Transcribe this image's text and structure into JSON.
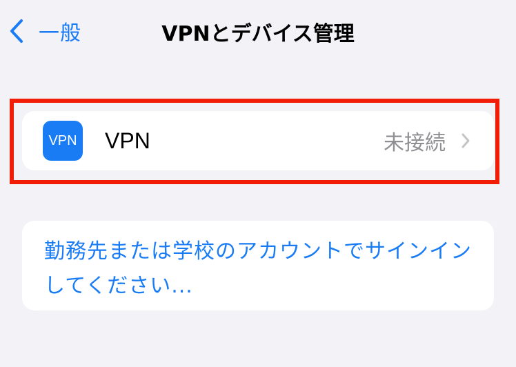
{
  "nav": {
    "back_label": "一般",
    "title": "VPNとデバイス管理"
  },
  "vpn_row": {
    "icon_text": "VPN",
    "label": "VPN",
    "status": "未接続"
  },
  "signin": {
    "text": "勤務先または学校のアカウントでサインインしてください..."
  },
  "colors": {
    "accent": "#1a7cf5",
    "highlight": "#f21d06",
    "background": "#f2f2f7",
    "secondary_text": "#8e8e93"
  },
  "icons": {
    "back": "chevron-left-icon",
    "row_disclosure": "chevron-right-icon",
    "vpn_app": "vpn-app-icon"
  }
}
